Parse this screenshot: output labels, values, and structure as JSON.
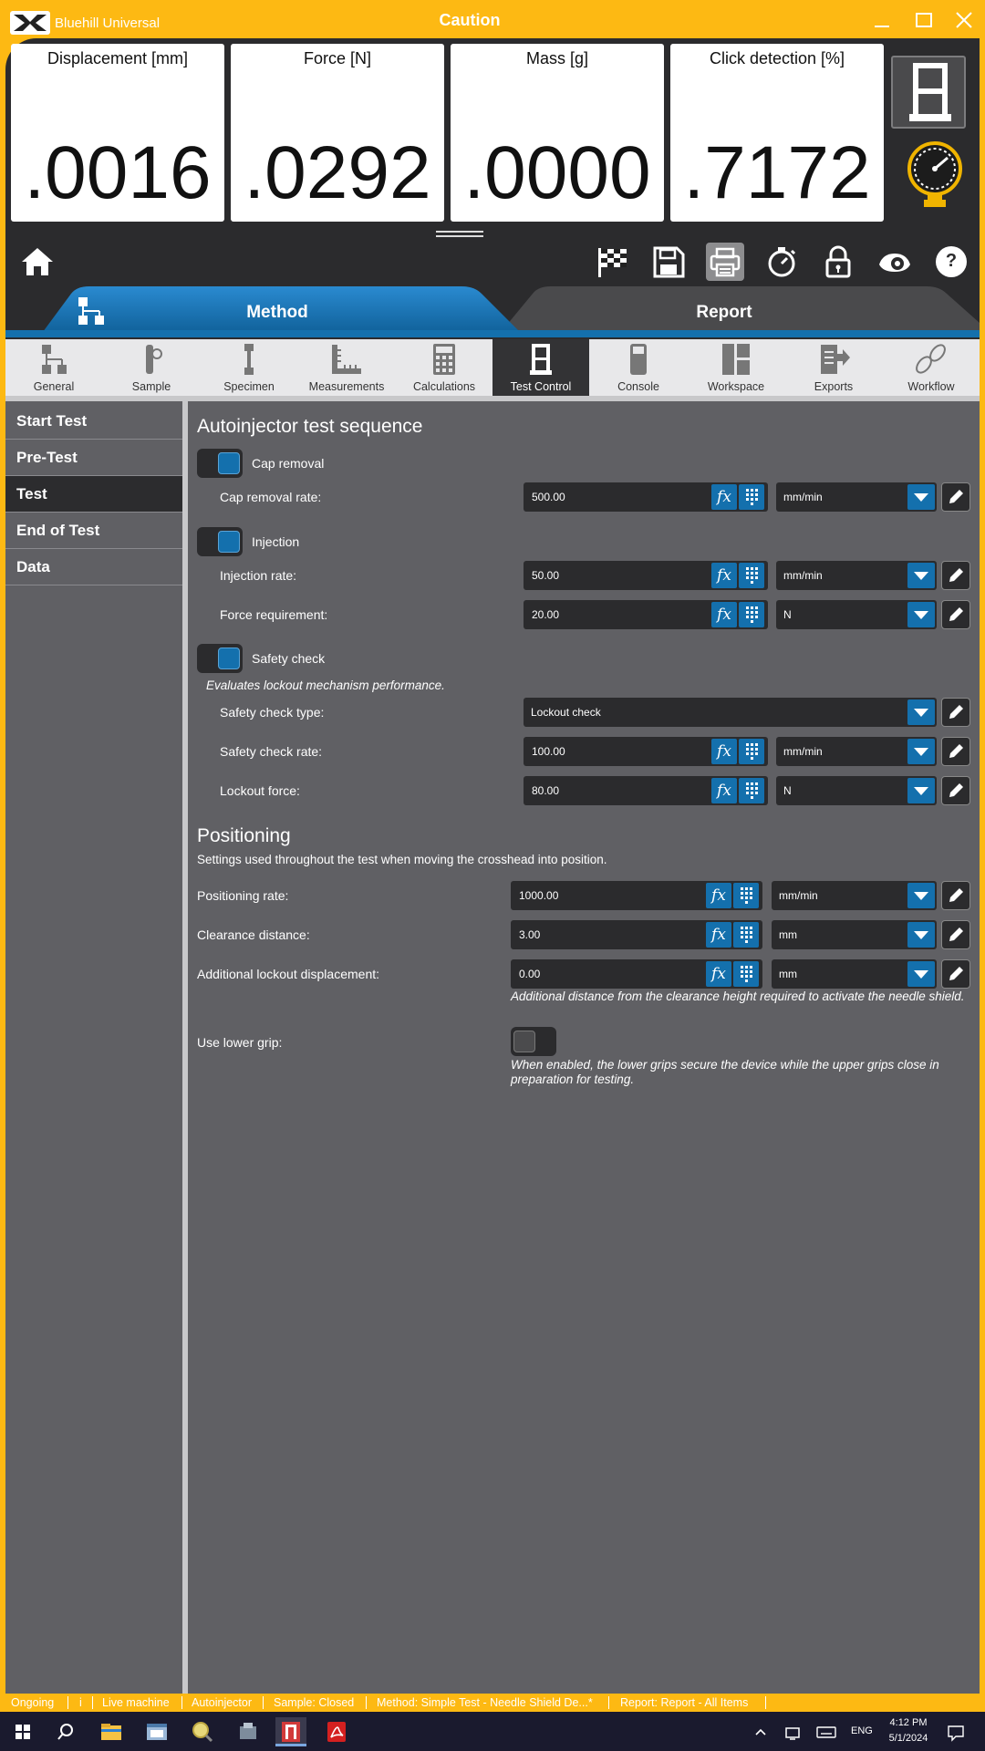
{
  "window": {
    "app_name": "Bluehill Universal",
    "status_title": "Caution"
  },
  "meters": [
    {
      "label": "Displacement [mm]",
      "value": ".0016"
    },
    {
      "label": "Force [N]",
      "value": ".0292"
    },
    {
      "label": "Mass [g]",
      "value": ".0000"
    },
    {
      "label": "Click detection [%]",
      "value": ".7172"
    }
  ],
  "toolbar": {
    "icons": [
      "home-icon",
      "finish-flag-icon",
      "save-icon",
      "print-icon",
      "stopwatch-icon",
      "lock-icon",
      "eye-icon",
      "help-icon"
    ],
    "help_label": "?"
  },
  "tabs": {
    "method": "Method",
    "report": "Report"
  },
  "toolstrip": [
    {
      "label": "General",
      "icon": "flowchart-icon"
    },
    {
      "label": "Sample",
      "icon": "sample-icon"
    },
    {
      "label": "Specimen",
      "icon": "specimen-icon"
    },
    {
      "label": "Measurements",
      "icon": "ruler-icon"
    },
    {
      "label": "Calculations",
      "icon": "calculator-icon"
    },
    {
      "label": "Test Control",
      "icon": "frame-icon"
    },
    {
      "label": "Console",
      "icon": "console-icon"
    },
    {
      "label": "Workspace",
      "icon": "workspace-icon"
    },
    {
      "label": "Exports",
      "icon": "export-icon"
    },
    {
      "label": "Workflow",
      "icon": "footsteps-icon"
    }
  ],
  "sidebar": {
    "items": [
      {
        "label": "Start Test"
      },
      {
        "label": "Pre-Test"
      },
      {
        "label": "Test"
      },
      {
        "label": "End of Test"
      },
      {
        "label": "Data"
      }
    ],
    "active": "Test"
  },
  "sequence": {
    "title": "Autoinjector test sequence",
    "cap_removal": {
      "toggle_label": "Cap removal",
      "enabled": true,
      "rate_label": "Cap removal rate:",
      "rate_value": "500.00",
      "rate_unit": "mm/min"
    },
    "injection": {
      "toggle_label": "Injection",
      "enabled": true,
      "rate_label": "Injection rate:",
      "rate_value": "50.00",
      "rate_unit": "mm/min",
      "force_label": "Force requirement:",
      "force_value": "20.00",
      "force_unit": "N"
    },
    "safety": {
      "toggle_label": "Safety check",
      "enabled": true,
      "description": "Evaluates lockout mechanism performance.",
      "type_label": "Safety check type:",
      "type_value": "Lockout check",
      "rate_label": "Safety check rate:",
      "rate_value": "100.00",
      "rate_unit": "mm/min",
      "force_label": "Lockout force:",
      "force_value": "80.00",
      "force_unit": "N"
    }
  },
  "positioning": {
    "title": "Positioning",
    "description": "Settings used throughout the test when moving the crosshead into position.",
    "rate_label": "Positioning rate:",
    "rate_value": "1000.00",
    "rate_unit": "mm/min",
    "clearance_label": "Clearance distance:",
    "clearance_value": "3.00",
    "clearance_unit": "mm",
    "lockout_label": "Additional lockout displacement:",
    "lockout_value": "0.00",
    "lockout_unit": "mm",
    "lockout_help": "Additional distance from the clearance height required to activate the needle shield.",
    "lower_grip_label": "Use lower grip:",
    "lower_grip_enabled": false,
    "lower_grip_help": "When enabled, the lower grips secure the device while the upper grips close in preparation for testing."
  },
  "fx_label": "fx",
  "statusbar": {
    "items": [
      "Ongoing",
      "i",
      "Live machine",
      "Autoinjector",
      "Sample: Closed",
      "Method: Simple Test - Needle Shield De...*",
      "Report: Report - All Items"
    ]
  },
  "taskbar": {
    "lang": "ENG",
    "time": "4:12 PM",
    "date": "5/1/2024"
  },
  "colors": {
    "accent": "#fdb913",
    "active_blue": "#1470ad",
    "panel": "#606064",
    "dark": "#2b2b2d"
  }
}
